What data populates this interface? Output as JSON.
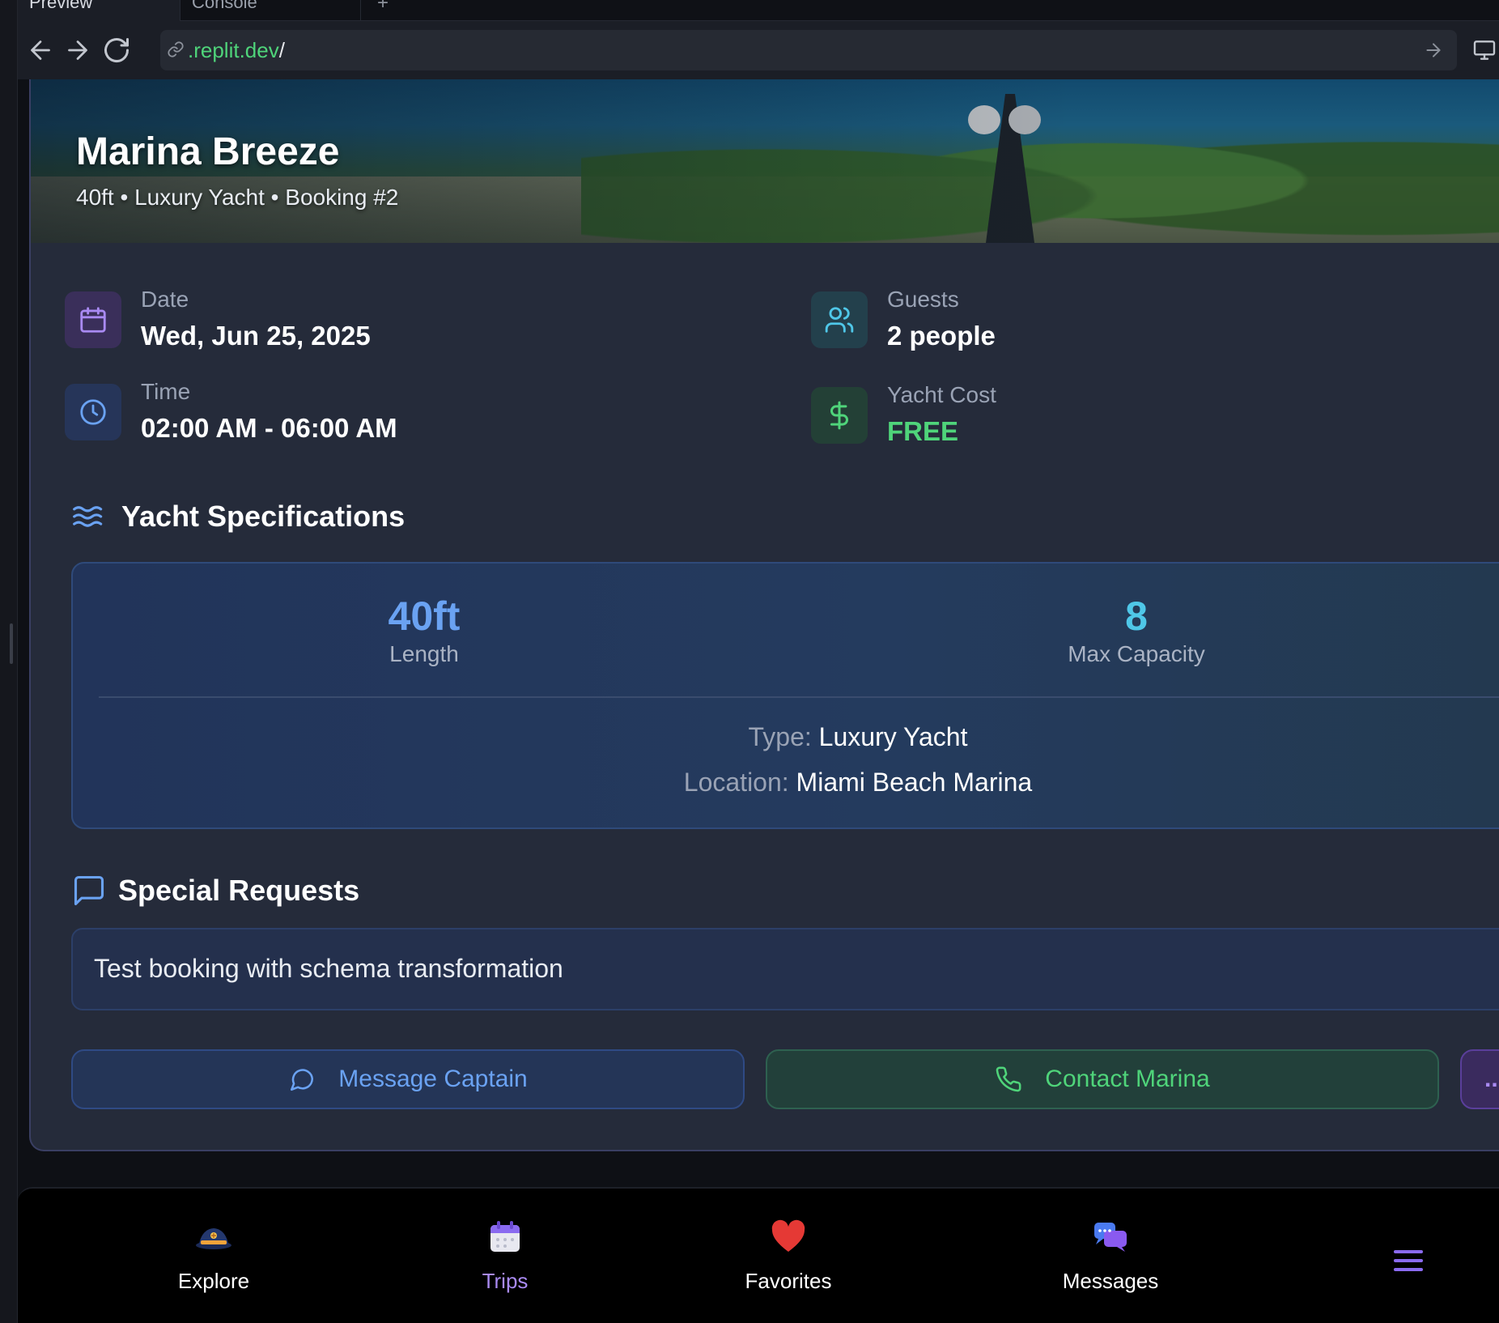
{
  "browser": {
    "tabs": [
      {
        "label": "Preview",
        "active": true
      },
      {
        "label": "Console",
        "active": false
      }
    ],
    "add_tab": "+",
    "url": {
      "host": ".replit.dev",
      "path": "/"
    }
  },
  "booking": {
    "title": "Marina Breeze",
    "subtitle": "40ft • Luxury Yacht • Booking #2",
    "date": {
      "label": "Date",
      "value": "Wed, Jun 25, 2025"
    },
    "guests": {
      "label": "Guests",
      "value": "2 people"
    },
    "time": {
      "label": "Time",
      "value": "02:00 AM - 06:00 AM"
    },
    "cost": {
      "label": "Yacht Cost",
      "value": "FREE"
    }
  },
  "specs": {
    "heading": "Yacht Specifications",
    "length": {
      "value": "40ft",
      "label": "Length"
    },
    "capacity": {
      "value": "8",
      "label": "Max Capacity"
    },
    "type": {
      "key": "Type:",
      "value": "Luxury Yacht"
    },
    "location": {
      "key": "Location:",
      "value": "Miami Beach Marina"
    }
  },
  "requests": {
    "heading": "Special Requests",
    "text": "Test booking with schema transformation"
  },
  "actions": {
    "message_captain": "Message Captain",
    "contact_marina": "Contact Marina",
    "more": "..."
  },
  "bottom_nav": {
    "items": [
      {
        "label": "Explore",
        "icon": "captain-hat-icon"
      },
      {
        "label": "Trips",
        "icon": "calendar-icon",
        "active": true
      },
      {
        "label": "Favorites",
        "icon": "heart-icon"
      },
      {
        "label": "Messages",
        "icon": "chat-bubbles-icon"
      }
    ],
    "menu_icon": "hamburger-menu-icon"
  },
  "colors": {
    "accent_purple": "#a98af2",
    "accent_blue": "#6aa2f2",
    "accent_green": "#4fd47a",
    "accent_cyan": "#4fc7e8",
    "card_bg": "#252b3a"
  }
}
